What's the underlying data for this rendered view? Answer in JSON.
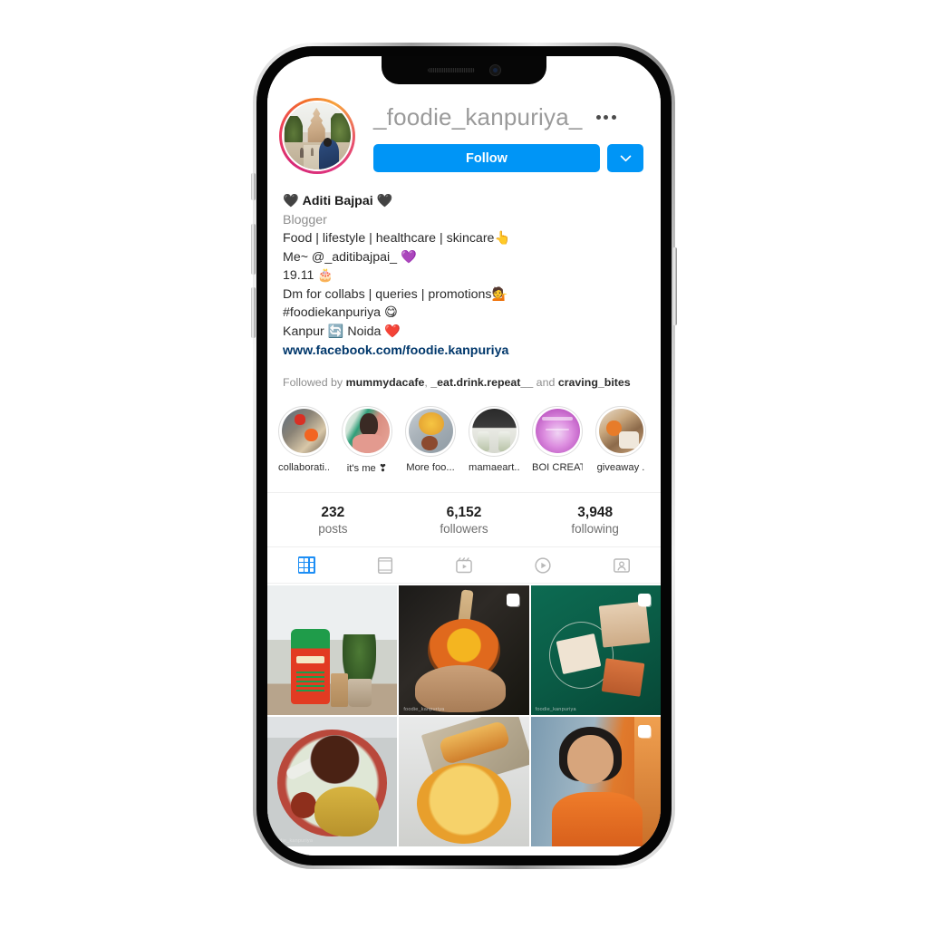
{
  "profile": {
    "username": "_foodie_kanpuriya_",
    "avatar_icon": "profile-avatar-monument-photo",
    "has_story_ring": true,
    "follow_label": "Follow",
    "caret_icon": "chevron-down-icon",
    "options_icon": "more-options-dots-icon",
    "bio": {
      "display_name": "Aditi Bajpai",
      "heart_left": "🖤",
      "heart_right": "🖤",
      "category": "Blogger",
      "line_niche": "Food | lifestyle | healthcare | skincare",
      "emoji_niche": "👆",
      "line_me": "Me~ @_aditibajpai_",
      "emoji_me": "💜",
      "line_date": "19.11",
      "emoji_date": "🎂",
      "line_dm": "Dm for collabs | queries | promotions",
      "emoji_dm": "💁",
      "line_hashtag": "#foodiekanpuriya",
      "emoji_hashtag": "😋",
      "line_city_from": "Kanpur",
      "emoji_city": "🔄",
      "line_city_to": "Noida",
      "emoji_city2": "❤️",
      "website": "www.facebook.com/foodie.kanpuriya"
    },
    "followed_by": {
      "prefix": "Followed by",
      "user1": "mummydacafe",
      "sep1": ",",
      "user2": "_eat.drink.repeat__",
      "conj": "and",
      "user3": "craving_bites"
    },
    "stats": [
      {
        "value": "232",
        "label": "posts"
      },
      {
        "value": "6,152",
        "label": "followers"
      },
      {
        "value": "3,948",
        "label": "following"
      }
    ],
    "highlights": [
      {
        "label": "collaborati...",
        "art": "h1"
      },
      {
        "label": "it's me ❣",
        "art": "h2"
      },
      {
        "label": "More foo...",
        "art": "h3"
      },
      {
        "label": "mamaeart...",
        "art": "h4"
      },
      {
        "label": "BOI CREAT...",
        "art": "h5"
      },
      {
        "label": "giveaway .",
        "art": "h6"
      }
    ],
    "tabs": [
      {
        "name": "grid",
        "icon": "grid-icon",
        "active": true
      },
      {
        "name": "feed",
        "icon": "single-post-icon",
        "active": false
      },
      {
        "name": "reels",
        "icon": "reels-icon",
        "active": false
      },
      {
        "name": "igtv",
        "icon": "video-play-icon",
        "active": false
      },
      {
        "name": "tagged",
        "icon": "tagged-user-icon",
        "active": false
      }
    ],
    "posts": [
      {
        "art": "p1",
        "multi": false,
        "watermark": ""
      },
      {
        "art": "p2",
        "multi": true,
        "watermark": "foodie_kanpuriya"
      },
      {
        "art": "p3",
        "multi": true,
        "watermark": "foodie_kanpuriya"
      },
      {
        "art": "p4",
        "multi": false,
        "watermark": "foodie_kanpuriya"
      },
      {
        "art": "p5",
        "multi": false,
        "watermark": ""
      },
      {
        "art": "p6",
        "multi": true,
        "watermark": ""
      }
    ]
  },
  "colors": {
    "instagram_blue": "#0095F6",
    "link_navy": "#00376B",
    "muted_gray": "#8E8E8E",
    "text_dark": "#262626",
    "border": "#EFEFEF"
  },
  "device": {
    "frame": "iphone-mockup",
    "notch_icons": [
      "speaker-grille",
      "front-camera"
    ],
    "side_buttons": [
      "mute-switch",
      "volume-up",
      "volume-down",
      "power-button"
    ]
  }
}
